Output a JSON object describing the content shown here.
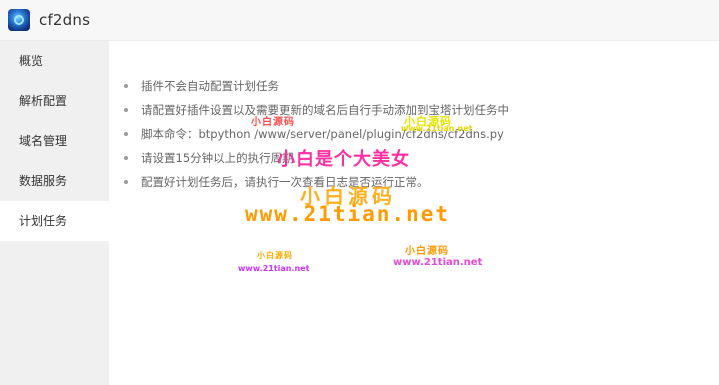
{
  "app": {
    "title": "cf2dns",
    "logo_icon": "app-logo-icon"
  },
  "sidebar": {
    "items": [
      {
        "label": "概览",
        "active": false
      },
      {
        "label": "解析配置",
        "active": false
      },
      {
        "label": "域名管理",
        "active": false
      },
      {
        "label": "数据服务",
        "active": false
      },
      {
        "label": "计划任务",
        "active": true
      }
    ]
  },
  "main": {
    "tips": [
      "插件不会自动配置计划任务",
      "请配置好插件设置以及需要更新的域名后自行手动添加到宝塔计划任务中",
      "脚本命令：btpython /www/server/panel/plugin/cf2dns/cf2dns.py",
      "请设置15分钟以上的执行周期",
      "配置好计划任务后，请执行一次查看日志是否运行正常。"
    ]
  },
  "watermarks": [
    "小白源码",
    "小白源码",
    "www.21tian.net",
    "小白是个大美女",
    "小白源码",
    "www.21tian.net",
    "小白源码",
    "www.21tian.net",
    "小白源码",
    "www.21tian.net"
  ],
  "colors": {
    "titlebar_bg": "#f7f7f7",
    "sidebar_bg": "#f0f0f0",
    "active_item_bg": "#ffffff",
    "text": "#333333",
    "tip_text": "#666666"
  }
}
